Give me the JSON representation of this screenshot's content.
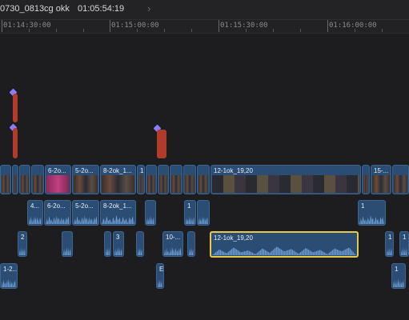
{
  "header": {
    "project_name": "0730_0813cg okk",
    "timecode": "01:05:54:19"
  },
  "ruler": {
    "labels": [
      "01:14:30:00",
      "01:15:00:00",
      "01:15:30:00",
      "01:16:00:00"
    ]
  },
  "clips": {
    "primary": [
      "6-2o...",
      "5-2o...",
      "8-2ok_1...",
      "1",
      "12-1ok_19,20",
      "15-..."
    ],
    "connected_upper": [
      "4...",
      "6-2o...",
      "5-2o...",
      "8-2ok_1...",
      "1",
      "1"
    ],
    "connected_lower": [
      "2",
      "3",
      "10-...",
      "12-1ok_19,20",
      "1",
      "1"
    ],
    "bottom": [
      "1-2...",
      "E",
      "1"
    ]
  },
  "colors": {
    "clip_fill": "#2b4d74",
    "selection": "#e8c94a",
    "marker": "#b03b2a"
  }
}
